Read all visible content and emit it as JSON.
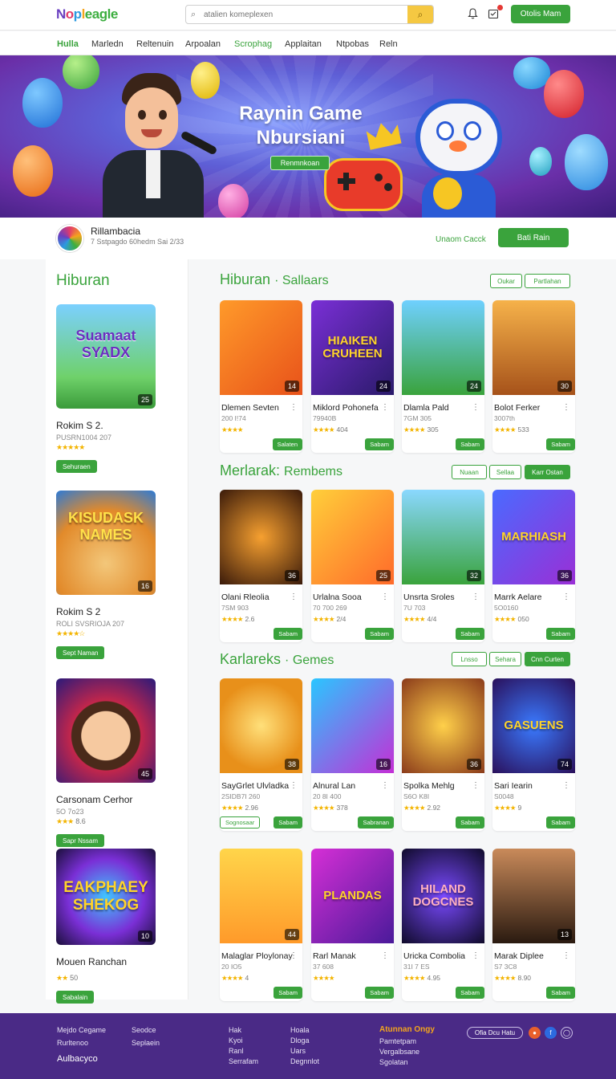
{
  "header": {
    "logo": [
      "N",
      "o",
      "p",
      "l",
      "eagle"
    ],
    "search_placeholder": "atalien komeplexen",
    "cta": "Otolis Mam"
  },
  "nav": [
    "Hulla",
    "Marledn",
    "Reltenuin",
    "Arpoalan",
    "Scrophag",
    "Applaitan",
    "Ntpobas",
    "Reln"
  ],
  "hero": {
    "title": "Raynin Game Nbursiani",
    "button": "Renmnkoan"
  },
  "profile": {
    "name": "Rillambacia",
    "sub": "7 Sstpagdo 60hedm Sai 2/33",
    "link": "Unaom Cacck",
    "button": "Bati Rain"
  },
  "sidebar": {
    "title": "Hiburan",
    "items": [
      {
        "art": "Suamaat SYADX",
        "badge": "25",
        "name": "Rokim S 2.",
        "meta": "PUSRN1004 207",
        "rating": "",
        "button": "Sehuraen"
      },
      {
        "art": "KISUDASK NAMES",
        "badge": "16",
        "name": "Rokim S 2",
        "meta": "ROLI SVSRIOJA 207",
        "rating": "",
        "button": "Sept Naman"
      },
      {
        "art": "",
        "badge": "45",
        "name": "Carsonam Cerhor",
        "meta": "5O 7o23",
        "rating": "8.6",
        "button": "Sapr Nssam"
      },
      {
        "art": "EAKPHAEY SHEKOG",
        "badge": "10",
        "name": "Mouen Ranchan",
        "meta": "",
        "rating": "50",
        "button": "Sabalain"
      }
    ]
  },
  "sections": [
    {
      "title": "Hiburan",
      "subtitle": "· Sallaars",
      "chips": [
        "Oukar",
        "Partlahan"
      ],
      "cards": [
        {
          "art": "",
          "badge": "14",
          "name": "Dlemen Sevten",
          "meta": "200 I!74",
          "rating": "",
          "button": "Salaten"
        },
        {
          "art": "HIAIKEN CRUHEEN",
          "badge": "24",
          "name": "Miklord Pohonefa",
          "meta": "79940B",
          "rating": "404",
          "button": "Sabam"
        },
        {
          "art": "",
          "badge": "24",
          "name": "Dlamla Pald",
          "meta": "7GM 305",
          "rating": "305",
          "button": "Sabam"
        },
        {
          "art": "",
          "badge": "30",
          "name": "Bolot Ferker",
          "meta": "3007th",
          "rating": "533",
          "button": "Sabam"
        }
      ]
    },
    {
      "title": "Merlarak:",
      "subtitle": "Rembems",
      "chips": [
        "Nuaan",
        "Sellaa",
        "Karr Ostan"
      ],
      "cards": [
        {
          "art": "",
          "badge": "36",
          "name": "Olani Rleolia",
          "meta": "7SM 903",
          "rating": "2.6",
          "button": "Sabam"
        },
        {
          "art": "",
          "badge": "25",
          "name": "Urlalna Sooa",
          "meta": "70 700 269",
          "rating": "2/4",
          "button": "Sabam"
        },
        {
          "art": "",
          "badge": "32",
          "name": "Unsrta Sroles",
          "meta": "7U 703",
          "rating": "4/4",
          "button": "Sabam"
        },
        {
          "art": "MARHIASH",
          "badge": "36",
          "name": "Marrk Aelare",
          "meta": "5O0160",
          "rating": "050",
          "button": "Sabam"
        }
      ]
    },
    {
      "title": "Karlareks",
      "subtitle": "· Gemes",
      "chips": [
        "Lnsso",
        "Sehara",
        "Cnn Curten"
      ],
      "cards": [
        {
          "art": "",
          "badge": "38",
          "name": "SayGrlet Ulvladka",
          "meta": "2SIDB7I 260",
          "rating": "2.96",
          "button": "Sabam",
          "button2": "Sognosaar"
        },
        {
          "art": "",
          "badge": "16",
          "name": "Alnural Lan",
          "meta": "20 8I 400",
          "rating": "378",
          "button": "Sabranan"
        },
        {
          "art": "",
          "badge": "36",
          "name": "Spolka Mehlg",
          "meta": "S6O K8I",
          "rating": "2.92",
          "button": "Sabam"
        },
        {
          "art": "GASUENS",
          "badge": "74",
          "name": "Sari Iearin",
          "meta": "S0048",
          "rating": "9",
          "button": "Sabam"
        }
      ]
    },
    {
      "title": "",
      "subtitle": "",
      "chips": [],
      "cards": [
        {
          "art": "",
          "badge": "44",
          "name": "Malaglar Ploylonay",
          "meta": "20 IO5",
          "rating": "4",
          "button": "Sabam"
        },
        {
          "art": "PLANDAS",
          "badge": "",
          "name": "Rarl Manak",
          "meta": "37 608",
          "rating": "",
          "button": "Sabam"
        },
        {
          "art": "HILAND DOGCNES",
          "badge": "",
          "name": "Uricka Combolia",
          "meta": "31I 7 ES",
          "rating": "4.95",
          "button": "Sabam"
        },
        {
          "art": "",
          "badge": "13",
          "name": "Marak Diplee",
          "meta": "S7 3C8",
          "rating": "8.90",
          "button": "Sabam"
        }
      ]
    }
  ],
  "footer": {
    "col1": [
      "Mejdo Cegame",
      "Rurltenoo"
    ],
    "brand": "Aulbacyco",
    "col2": [
      "Seodce",
      "Seplaein"
    ],
    "col3": [
      "Hak",
      "Kyoi",
      "Ranl",
      "Serrafam"
    ],
    "col4": [
      "Hoala",
      "Dloga",
      "Uars",
      "Degnnlot"
    ],
    "col5_head": "Atunnan Ongy",
    "col5": [
      "Pamtetpam",
      "Vergalbsane",
      "Sgolatan"
    ],
    "pill": "Ofia Dcu Hatu"
  },
  "colors": {
    "brand_green": "#3aa33c",
    "footer_purple": "#4a2a86",
    "star": "#f3b400"
  }
}
